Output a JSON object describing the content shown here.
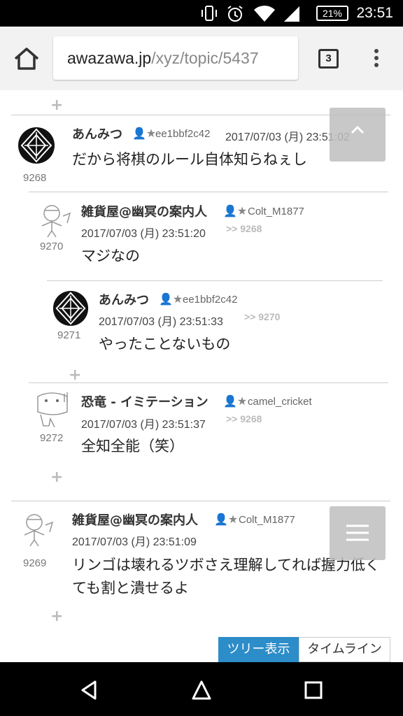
{
  "status": {
    "battery": "21%",
    "time": "23:51"
  },
  "browser": {
    "url_host": "awazawa.jp",
    "url_path": "/xyz/topic/5437",
    "tab_count": "3"
  },
  "posts": [
    {
      "number": "9268",
      "name": "あんみつ",
      "user_id": "ee1bbf2c42",
      "date": "2017/07/03 (月) 23:51:02",
      "reply_to": "",
      "body": "だから将棋のルール自体知らねぇし"
    },
    {
      "number": "9270",
      "name": "雑貨屋@幽冥の案内人",
      "user_id": "Colt_M1877",
      "date": "2017/07/03 (月) 23:51:20",
      "reply_to": ">> 9268",
      "body": "マジなの"
    },
    {
      "number": "9271",
      "name": "あんみつ",
      "user_id": "ee1bbf2c42",
      "date": "2017/07/03 (月) 23:51:33",
      "reply_to": ">> 9270",
      "body": "やったことないもの"
    },
    {
      "number": "9272",
      "name": "恐竜 - イミテーション",
      "user_id": "camel_cricket",
      "date": "2017/07/03 (月) 23:51:37",
      "reply_to": ">> 9268",
      "body": "全知全能（笑）"
    },
    {
      "number": "9269",
      "name": "雑貨屋@幽冥の案内人",
      "user_id": "Colt_M1877",
      "date": "2017/07/03 (月) 23:51:09",
      "reply_to": "",
      "body": "リンゴは壊れるツボさえ理解してれば握力低くても割と潰せるよ"
    }
  ],
  "user_icon": "👤★",
  "plus_sign": "+",
  "view_toggle": {
    "tree": "ツリー表示",
    "timeline": "タイムライン",
    "active": "tree"
  },
  "colors": {
    "accent": "#2d8dc9",
    "status_bar": "#000000",
    "toolbar": "#f2f2f2"
  }
}
